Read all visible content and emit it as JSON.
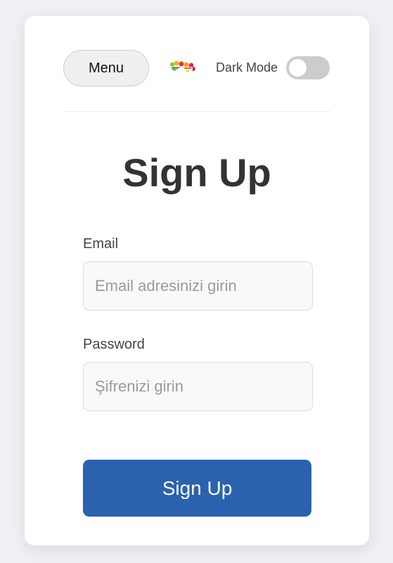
{
  "header": {
    "menu_label": "Menu",
    "logo_alt": "FoodLens",
    "dark_mode_label": "Dark Mode",
    "dark_mode_on": false
  },
  "form": {
    "title": "Sign Up",
    "email_label": "Email",
    "email_placeholder": "Email adresinizi girin",
    "password_label": "Password",
    "password_placeholder": "Şifrenizi girin",
    "submit_label": "Sign Up"
  },
  "colors": {
    "primary": "#2a62ae",
    "background": "#eef0f4",
    "card": "#ffffff",
    "toggle_off": "#cccccc"
  }
}
